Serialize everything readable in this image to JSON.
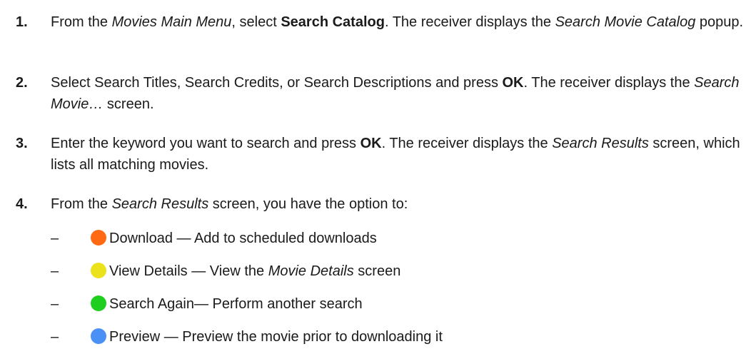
{
  "steps": [
    {
      "number": "1.",
      "t1": "From the ",
      "e1": "Movies Main Menu",
      "t2": ", select ",
      "b1": "Search Catalog",
      "t3": ". The receiver displays the ",
      "e2": "Search Movie Catalog",
      "t4": " popup."
    },
    {
      "number": "2.",
      "t1": "Select Search Titles, Search Credits, or Search Descriptions and press ",
      "b1": "OK",
      "t2": ". The receiver displays the ",
      "e1": "Search Movie…",
      "t3": " screen."
    },
    {
      "number": "3.",
      "t1": "Enter the keyword you want to search and press ",
      "b1": "OK",
      "t2": ". The receiver displays the ",
      "e1": "Search Results",
      "t3": " screen, which lists all matching movies."
    },
    {
      "number": "4.",
      "t1": "From the ",
      "e1": "Search Results",
      "t2": " screen, you have the option to:"
    }
  ],
  "options": [
    {
      "dash": "–",
      "color": "#ff6a13",
      "label": "Download — Add to scheduled downloads"
    },
    {
      "dash": "–",
      "color": "#ece21c",
      "label": "View Details — View the ",
      "emph": "Movie Details",
      "after": " screen"
    },
    {
      "dash": "–",
      "color": "#1fcf1f",
      "label": "Search Again— Perform another search"
    },
    {
      "dash": "–",
      "color": "#4a90f5",
      "label": "Preview — Preview the movie prior to downloading it"
    }
  ]
}
